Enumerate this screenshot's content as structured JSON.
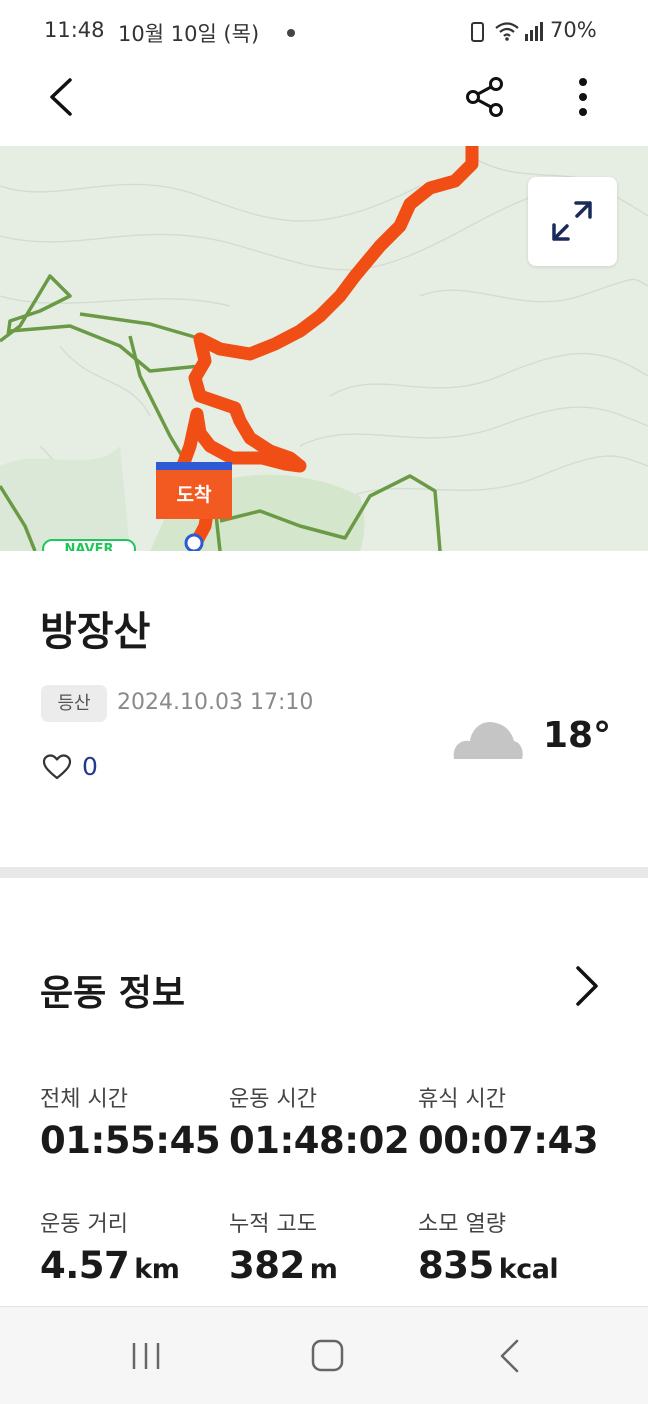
{
  "status_bar": {
    "time": "11:48",
    "date": "10월 10일 (목)",
    "battery": "70%",
    "icons": [
      "battery-saver-icon",
      "wifi-icon",
      "signal-icon"
    ]
  },
  "app_bar": {
    "icons": [
      "back-icon",
      "share-icon",
      "more-vert-icon"
    ]
  },
  "map": {
    "arrive_label": "도착",
    "naver_label": "NAVER",
    "route_color": "#f04e14",
    "trail_color": "#6b9a46",
    "background_color": "#e6eee4",
    "expand_icon": "expand-icon"
  },
  "summary": {
    "title": "방장산",
    "tag": "등산",
    "datetime": "2024.10.03 17:10",
    "likes": "0",
    "weather_icon": "cloud-icon",
    "temperature": "18°"
  },
  "stats": {
    "section_title": "운동 정보",
    "items": [
      {
        "label": "전체 시간",
        "value": "01:55:45",
        "unit": ""
      },
      {
        "label": "운동 시간",
        "value": "01:48:02",
        "unit": ""
      },
      {
        "label": "휴식 시간",
        "value": "00:07:43",
        "unit": ""
      },
      {
        "label": "운동 거리",
        "value": "4.57",
        "unit": "km"
      },
      {
        "label": "누적 고도",
        "value": "382",
        "unit": "m"
      },
      {
        "label": "소모 열량",
        "value": "835",
        "unit": "kcal"
      }
    ]
  },
  "nav_bar": {
    "icons": [
      "recent-apps-icon",
      "home-icon",
      "back-nav-icon"
    ]
  }
}
